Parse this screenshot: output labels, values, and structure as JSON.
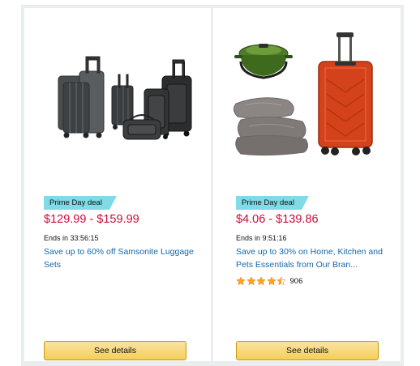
{
  "deals": [
    {
      "badge": "Prime Day deal",
      "price": "$129.99 - $159.99",
      "ends": "Ends in 33:56:15",
      "title": "Save up to 60% off Samsonite Luggage Sets",
      "button": "See details",
      "image": "samsonite-luggage-set"
    },
    {
      "badge": "Prime Day deal",
      "price": "$4.06 - $139.86",
      "ends": "Ends in 9:51:16",
      "title": "Save up to 30% on Home, Kitchen and Pets Essentials from Our Bran...",
      "rating": {
        "stars": 4.5,
        "count": "906"
      },
      "button": "See details",
      "image": "home-kitchen-essentials"
    }
  ],
  "colors": {
    "price": "#cc0c39",
    "link": "#1568a8",
    "badge": "#7fdbe6",
    "button": "#f4cf58",
    "star": "#ffa41c"
  }
}
